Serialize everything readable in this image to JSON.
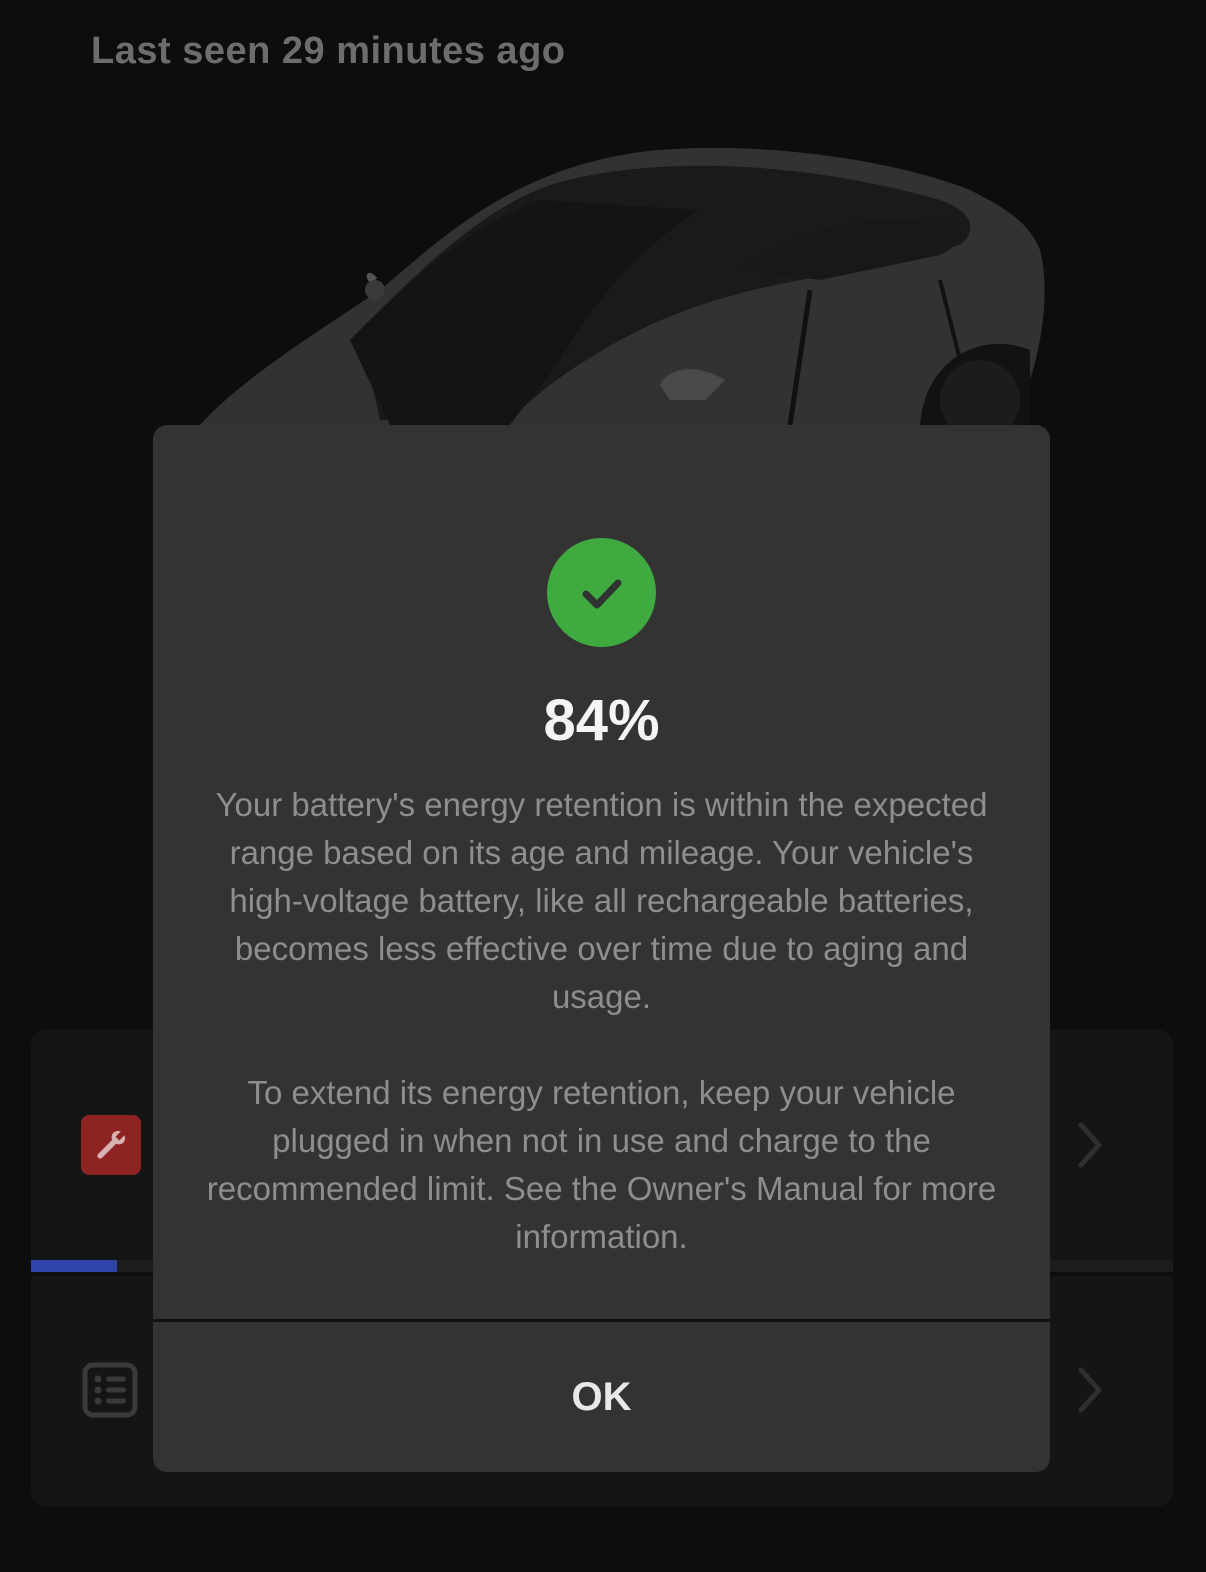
{
  "status": {
    "last_seen": "Last seen 29 minutes ago"
  },
  "background_cards": {
    "service_icon": "wrench-icon",
    "records_icon": "list-icon",
    "service_progress_percent": 7.5
  },
  "modal": {
    "icon": "checkmark-circle-icon",
    "icon_color": "#3faa3f",
    "percentage": "84%",
    "message_paragraph_1": "Your battery's energy retention is within the expected range based on its age and mileage. Your vehicle's high-voltage battery, like all rechargeable batteries, becomes less effective over time due to aging and usage.",
    "message_paragraph_2": "To extend its energy retention, keep your vehicle plugged in when not in use and charge to the recommended limit. See the Owner's Manual for more information.",
    "ok_label": "OK"
  },
  "colors": {
    "background": "#0c0d0e",
    "modal": "#333334",
    "accent_blue": "#2f44a8",
    "service_red": "#8e2324"
  }
}
